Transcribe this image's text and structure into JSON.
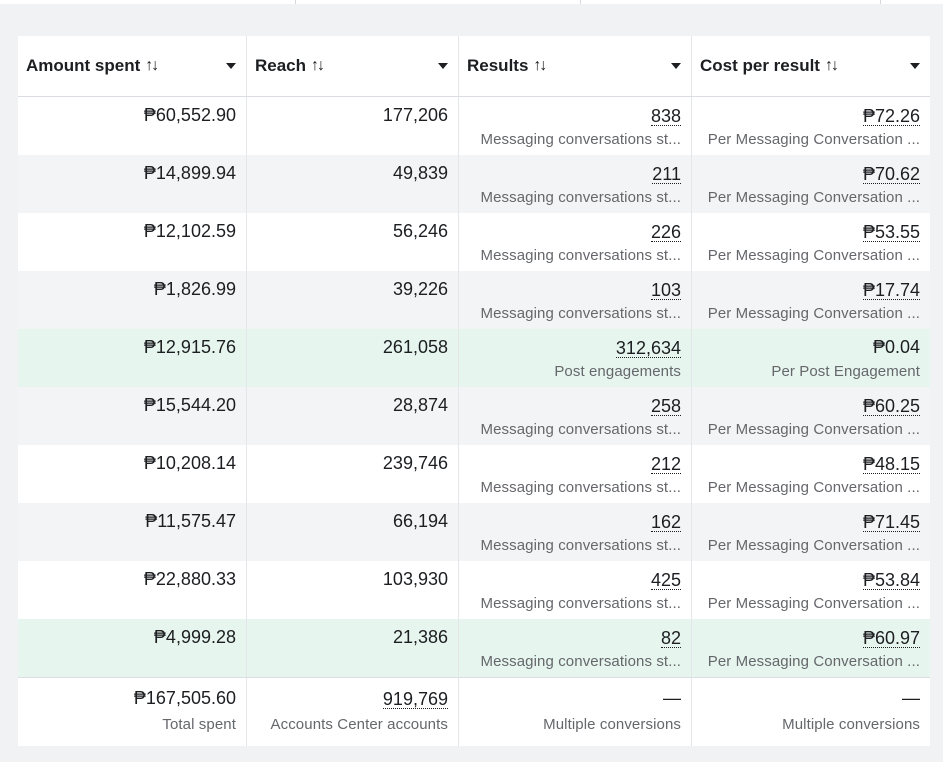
{
  "columns": [
    {
      "label": "Amount spent",
      "sort": "↑↓"
    },
    {
      "label": "Reach",
      "sort": "↑↓"
    },
    {
      "label": "Results",
      "sort": "↑↓"
    },
    {
      "label": "Cost per result",
      "sort": "↑↓"
    }
  ],
  "rows": [
    {
      "amount": "₱60,552.90",
      "reach": "177,206",
      "results": "838",
      "results_type": "Messaging conversations st...",
      "cost": "₱72.26",
      "cost_type": "Per Messaging Conversation ..."
    },
    {
      "amount": "₱14,899.94",
      "reach": "49,839",
      "results": "211",
      "results_type": "Messaging conversations st...",
      "cost": "₱70.62",
      "cost_type": "Per Messaging Conversation ..."
    },
    {
      "amount": "₱12,102.59",
      "reach": "56,246",
      "results": "226",
      "results_type": "Messaging conversations st...",
      "cost": "₱53.55",
      "cost_type": "Per Messaging Conversation ..."
    },
    {
      "amount": "₱1,826.99",
      "reach": "39,226",
      "results": "103",
      "results_type": "Messaging conversations st...",
      "cost": "₱17.74",
      "cost_type": "Per Messaging Conversation ..."
    },
    {
      "amount": "₱12,915.76",
      "reach": "261,058",
      "results": "312,634",
      "results_type": "Post engagements",
      "cost": "₱0.04",
      "cost_type": "Per Post Engagement"
    },
    {
      "amount": "₱15,544.20",
      "reach": "28,874",
      "results": "258",
      "results_type": "Messaging conversations st...",
      "cost": "₱60.25",
      "cost_type": "Per Messaging Conversation ..."
    },
    {
      "amount": "₱10,208.14",
      "reach": "239,746",
      "results": "212",
      "results_type": "Messaging conversations st...",
      "cost": "₱48.15",
      "cost_type": "Per Messaging Conversation ..."
    },
    {
      "amount": "₱11,575.47",
      "reach": "66,194",
      "results": "162",
      "results_type": "Messaging conversations st...",
      "cost": "₱71.45",
      "cost_type": "Per Messaging Conversation ..."
    },
    {
      "amount": "₱22,880.33",
      "reach": "103,930",
      "results": "425",
      "results_type": "Messaging conversations st...",
      "cost": "₱53.84",
      "cost_type": "Per Messaging Conversation ..."
    },
    {
      "amount": "₱4,999.28",
      "reach": "21,386",
      "results": "82",
      "results_type": "Messaging conversations st...",
      "cost": "₱60.97",
      "cost_type": "Per Messaging Conversation ..."
    }
  ],
  "totals": {
    "amount": "₱167,505.60",
    "amount_label": "Total spent",
    "reach": "919,769",
    "reach_label": "Accounts Center accounts",
    "results": "—",
    "results_label": "Multiple conversions",
    "cost": "—",
    "cost_label": "Multiple conversions"
  }
}
